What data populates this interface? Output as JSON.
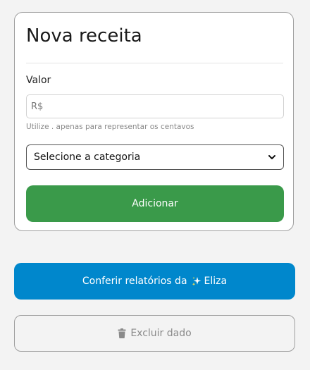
{
  "form": {
    "title": "Nova receita",
    "value_label": "Valor",
    "value_placeholder": "R$",
    "value_hint": "Utilize . apenas para representar os centavos",
    "category_selected": "Selecione a categoria",
    "submit_label": "Adicionar"
  },
  "actions": {
    "report_label_prefix": "Conferir relatórios da",
    "report_label_name": "Eliza",
    "delete_label": "Excluir dado"
  },
  "icons": {
    "category": "chevron-down-icon",
    "report": "sparkle-icon",
    "delete": "trash-icon"
  },
  "colors": {
    "submit": "#3a9a4a",
    "report": "#0087cc",
    "delete_text": "#8a8a8a"
  }
}
